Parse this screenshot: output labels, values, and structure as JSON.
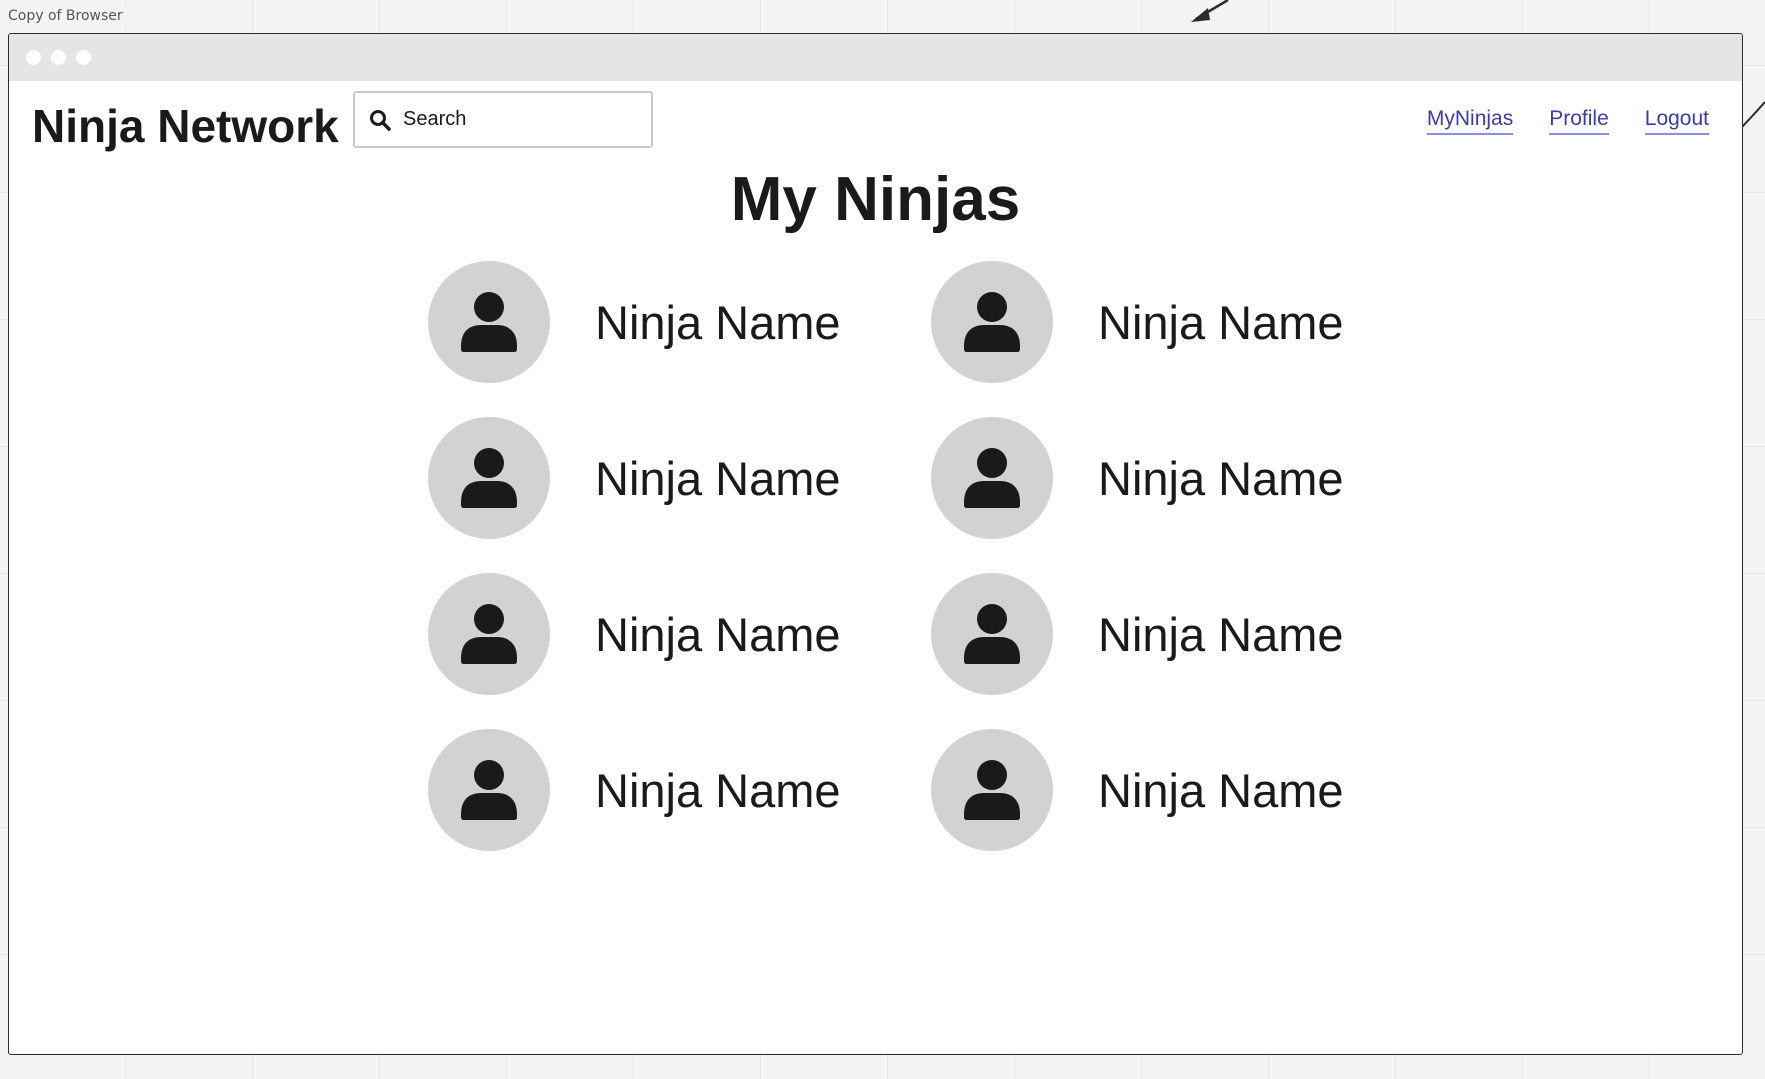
{
  "frame": {
    "label": "Copy of Browser"
  },
  "header": {
    "brand": "Ninja Network",
    "search": {
      "placeholder": "Search",
      "icon": "search-icon"
    },
    "nav": [
      {
        "label": "MyNinjas"
      },
      {
        "label": "Profile"
      },
      {
        "label": "Logout"
      }
    ]
  },
  "main": {
    "title": "My Ninjas",
    "ninjas": [
      {
        "name": "Ninja Name",
        "icon": "user-icon"
      },
      {
        "name": "Ninja Name",
        "icon": "user-icon"
      },
      {
        "name": "Ninja Name",
        "icon": "user-icon"
      },
      {
        "name": "Ninja Name",
        "icon": "user-icon"
      },
      {
        "name": "Ninja Name",
        "icon": "user-icon"
      },
      {
        "name": "Ninja Name",
        "icon": "user-icon"
      },
      {
        "name": "Ninja Name",
        "icon": "user-icon"
      },
      {
        "name": "Ninja Name",
        "icon": "user-icon"
      }
    ]
  },
  "colors": {
    "link": "#3c3ca8",
    "avatar_bg": "#d2d2d2",
    "titlebar": "#e5e5e5",
    "text": "#1a1a1a"
  }
}
